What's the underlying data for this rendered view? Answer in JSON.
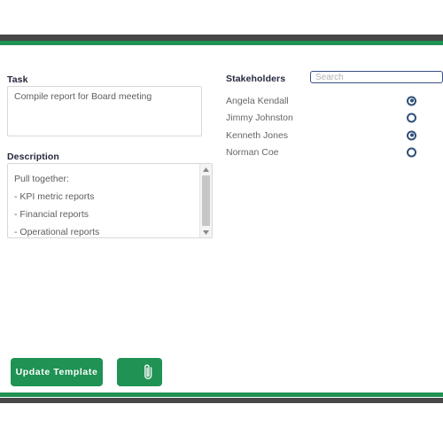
{
  "window": {
    "accent_green": "#1f9254",
    "bar_dark": "#474747",
    "heading_color": "#25283d",
    "radio_color": "#2f4f7a",
    "search_border": "#3a4f86"
  },
  "task": {
    "label": "Task",
    "value": "Compile report for Board meeting"
  },
  "description": {
    "label": "Description",
    "lines": [
      "Pull together:",
      "- KPI metric reports",
      "- Financial reports",
      "- Operational reports"
    ],
    "scrollbar": {
      "up_arrow_icon": "triangle-up-icon",
      "down_arrow_icon": "triangle-down-icon"
    }
  },
  "stakeholders": {
    "label": "Stakeholders",
    "search": {
      "placeholder": "Search",
      "value": ""
    },
    "people": [
      {
        "name": "Angela Kendall",
        "selected": true
      },
      {
        "name": "Jimmy Johnston",
        "selected": false
      },
      {
        "name": "Kenneth Jones",
        "selected": true
      },
      {
        "name": "Norman Coe",
        "selected": false
      }
    ]
  },
  "footer": {
    "update_label": "Update Template",
    "attach_icon": "paperclip-icon"
  }
}
